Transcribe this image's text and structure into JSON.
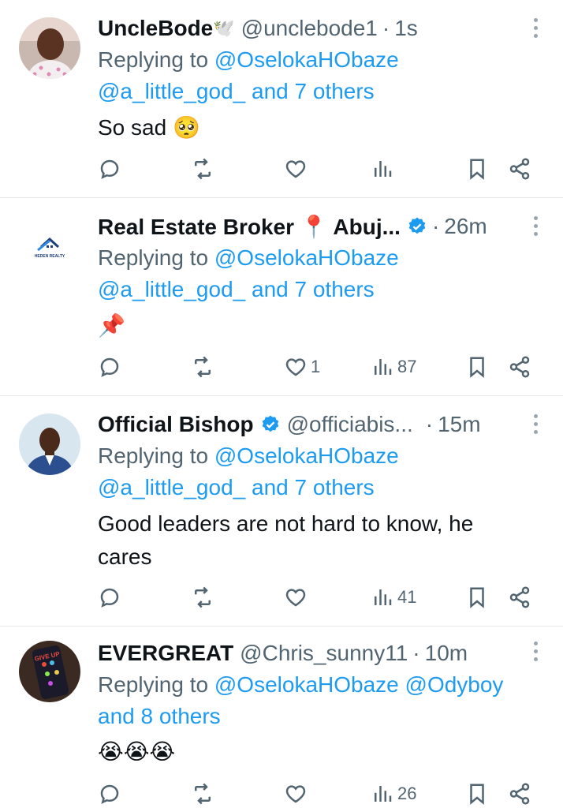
{
  "tweets": [
    {
      "name": "UncleBode",
      "name_emoji": "🕊️",
      "handle": "@unclebode1",
      "separator": "·",
      "time": "1s",
      "replying_prefix": "Replying to",
      "mention_1": "@OselokaHObaze",
      "mention_2": "@a_little_god_",
      "and_others": "and 7 others",
      "text": "So sad 🥺",
      "likes": "",
      "views": ""
    },
    {
      "name": "Real Estate Broker 📍 Abuj...",
      "handle": "",
      "separator": "·",
      "time": "26m",
      "replying_prefix": "Replying to",
      "mention_1": "@OselokaHObaze",
      "mention_2": "@a_little_god_",
      "and_others": "and 7 others",
      "text": "📌",
      "likes": "1",
      "views": "87",
      "avatar_logo_text": "HEDEN REALTY"
    },
    {
      "name": "Official Bishop",
      "handle": "@officiabis...",
      "separator": "·",
      "time": "15m",
      "replying_prefix": "Replying to",
      "mention_1": "@OselokaHObaze",
      "mention_2": "@a_little_god_",
      "and_others": "and 7 others",
      "text": "Good leaders are not hard to know, he cares",
      "likes": "",
      "views": "41"
    },
    {
      "name": "EVERGREAT",
      "handle": "@Chris_sunny11",
      "separator": "·",
      "time": "10m",
      "replying_prefix": "Replying to",
      "mention_1": "@OselokaHObaze",
      "mention_2": "@Odyboy",
      "and_others": "and 8 others",
      "text": "😭😭😭",
      "likes": "",
      "views": "26"
    }
  ],
  "colors": {
    "accent": "#1d9bf0",
    "secondary_text": "#536471",
    "primary_text": "#0f1419",
    "verified": "#1d9bf0"
  },
  "icons": {
    "reply": "reply-icon",
    "retweet": "retweet-icon",
    "like": "heart-icon",
    "views": "views-icon",
    "bookmark": "bookmark-icon",
    "share": "share-icon",
    "more": "more-vertical-icon",
    "verified": "verified-badge-icon"
  }
}
